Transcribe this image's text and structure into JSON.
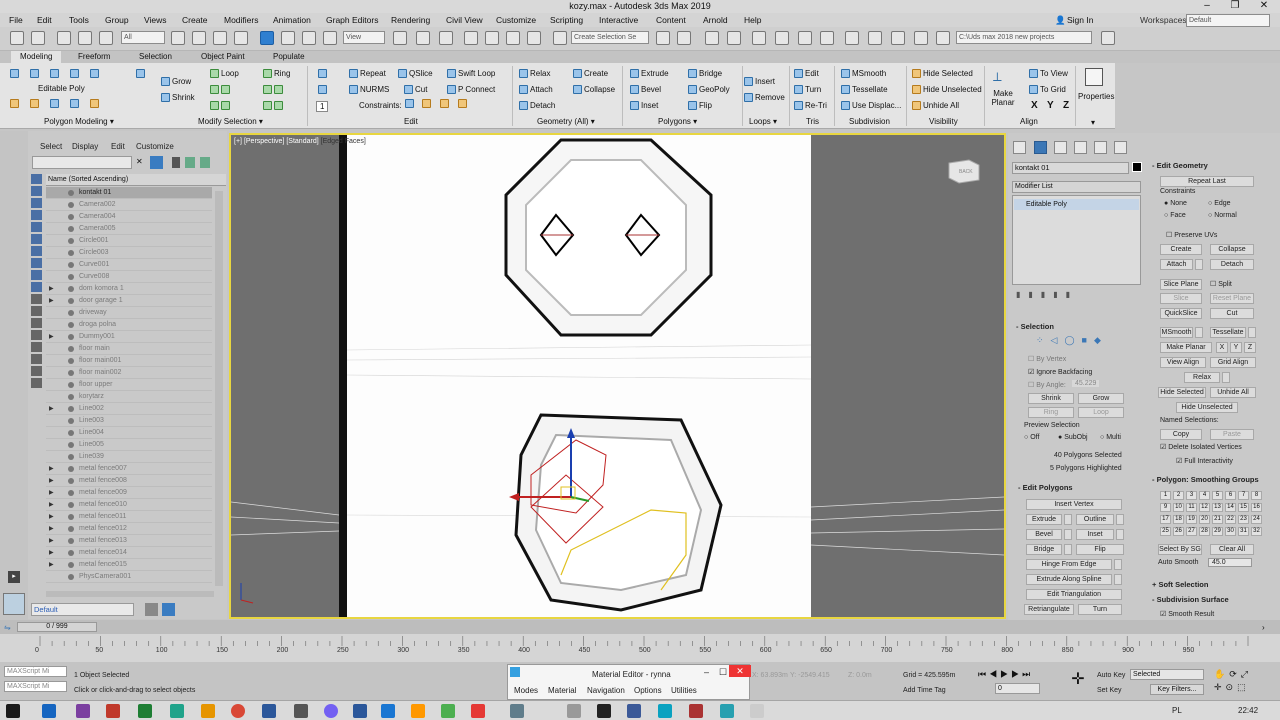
{
  "title": "kozy.max - Autodesk 3ds Max 2019",
  "menu": [
    "File",
    "Edit",
    "Tools",
    "Group",
    "Views",
    "Create",
    "Modifiers",
    "Animation",
    "Graph Editors",
    "Rendering",
    "Civil View",
    "Customize",
    "Scripting",
    "Interactive",
    "Content",
    "Arnold",
    "Help"
  ],
  "signin": "Sign In",
  "workspaces_label": "Workspaces:",
  "workspace": "Default",
  "toolbar": {
    "filter": "All",
    "view": "View",
    "selection_set": "Create Selection Se",
    "project_path": "C:\\Uds max 2018 new projects"
  },
  "ribbon_tabs": [
    "Modeling",
    "Freeform",
    "Selection",
    "Object Paint",
    "Populate"
  ],
  "ribbon": {
    "editable_poly": "Editable Poly",
    "grow": "Grow",
    "shrink": "Shrink",
    "loop": "Loop",
    "ring": "Ring",
    "repeat": "Repeat",
    "qslice": "QSlice",
    "swift_loop": "Swift Loop",
    "nurms": "NURMS",
    "cut": "Cut",
    "p_connect": "P Connect",
    "constraints": "Constraints:",
    "relax": "Relax",
    "create": "Create",
    "attach": "Attach",
    "collapse": "Collapse",
    "detach": "Detach",
    "extrude": "Extrude",
    "bridge": "Bridge",
    "bevel": "Bevel",
    "geopoly": "GeoPoly",
    "inset": "Inset",
    "flip": "Flip",
    "insert": "Insert",
    "remove": "Remove",
    "edit": "Edit",
    "turn": "Turn",
    "re_tri": "Re-Tri",
    "msmooth": "MSmooth",
    "tessellate": "Tessellate",
    "use_displac": "Use Displac...",
    "hide_selected": "Hide Selected",
    "hide_unselected": "Hide Unselected",
    "unhide_all": "Unhide All",
    "make_planar": "Make Planar",
    "to_view": "To View",
    "to_grid": "To Grid",
    "x": "X",
    "y": "Y",
    "z": "Z",
    "properties": "Properties",
    "footer": [
      "Polygon Modeling ▾",
      "Modify Selection ▾",
      "Edit",
      "Geometry (All) ▾",
      "Polygons ▾",
      "Loops ▾",
      "Tris",
      "Subdivision",
      "Visibility",
      "Align"
    ]
  },
  "explorer": {
    "menu": [
      "Select",
      "Display",
      "Edit",
      "Customize"
    ],
    "header": "Name (Sorted Ascending)",
    "rows": [
      "kontakt 01",
      "Camera002",
      "Camera004",
      "Camera005",
      "Circle001",
      "Circle003",
      "Curve001",
      "Curve008",
      "dom komora 1",
      "door garage 1",
      "driveway",
      "droga polna",
      "Dummy001",
      "floor main",
      "floor main001",
      "floor main002",
      "floor upper",
      "korytarz",
      "Line002",
      "Line003",
      "Line004",
      "Line005",
      "Line039",
      "metal fence007",
      "metal fence008",
      "metal fence009",
      "metal fence010",
      "metal fence011",
      "metal fence012",
      "metal fence013",
      "metal fence014",
      "metal fence015",
      "PhysCamera001"
    ],
    "expandable": [
      8,
      9,
      12,
      18,
      23,
      24,
      25,
      26,
      27,
      28,
      29,
      30,
      31
    ],
    "layer": "Default"
  },
  "viewport": {
    "label_parts": [
      "[+]",
      "[Perspective]",
      "[Standard]",
      "[Edged Faces]"
    ],
    "viewcube": "BACK"
  },
  "command": {
    "object_name": "kontakt 01",
    "modifier_list": "Modifier List",
    "stack_item": "Editable Poly",
    "selection": {
      "title": "Selection",
      "by_vertex": "By Vertex",
      "ignore_backfacing": "Ignore Backfacing",
      "by_angle": "By Angle:",
      "angle": "45.229",
      "shrink": "Shrink",
      "grow": "Grow",
      "ring": "Ring",
      "loop": "Loop",
      "preview": "Preview Selection",
      "off": "Off",
      "subobj": "SubObj",
      "multi": "Multi",
      "count1": "40 Polygons Selected",
      "count2": "5 Polygons Highlighted"
    },
    "edit_polygons": {
      "title": "Edit Polygons",
      "insert_vertex": "Insert Vertex",
      "extrude": "Extrude",
      "outline": "Outline",
      "bevel": "Bevel",
      "inset": "Inset",
      "bridge": "Bridge",
      "flip": "Flip",
      "hinge": "Hinge From Edge",
      "extrude_spline": "Extrude Along Spline",
      "edit_tri": "Edit Triangulation",
      "retriangulate": "Retriangulate",
      "turn": "Turn"
    },
    "edit_geometry": {
      "title": "Edit Geometry",
      "repeat_last": "Repeat Last",
      "constraints": "Constraints",
      "none": "None",
      "edge": "Edge",
      "face": "Face",
      "normal": "Normal",
      "preserve_uvs": "Preserve UVs",
      "create": "Create",
      "collapse": "Collapse",
      "attach": "Attach",
      "detach": "Detach",
      "slice_plane": "Slice Plane",
      "split": "Split",
      "slice": "Slice",
      "reset_plane": "Reset Plane",
      "quickslice": "QuickSlice",
      "cut": "Cut",
      "msmooth": "MSmooth",
      "tessellate": "Tessellate",
      "make_planar": "Make Planar",
      "x": "X",
      "y": "Y",
      "z": "Z",
      "view_align": "View Align",
      "grid_align": "Grid Align",
      "relax": "Relax",
      "hide_selected": "Hide Selected",
      "unhide_all": "Unhide All",
      "hide_unselected": "Hide Unselected",
      "named_selections": "Named Selections:",
      "copy": "Copy",
      "paste": "Paste",
      "delete_isolated": "Delete Isolated Vertices",
      "full_interactivity": "Full Interactivity"
    },
    "smoothing": {
      "title": "Polygon: Smoothing Groups",
      "groups": [
        1,
        2,
        3,
        4,
        5,
        6,
        7,
        8,
        9,
        10,
        11,
        12,
        13,
        14,
        15,
        16,
        17,
        18,
        19,
        20,
        21,
        22,
        23,
        24,
        25,
        26,
        27,
        28,
        29,
        30,
        31,
        32
      ],
      "select_by_sg": "Select By SG",
      "clear_all": "Clear All",
      "auto_smooth": "Auto Smooth",
      "auto_value": "45.0"
    },
    "soft_selection": "Soft Selection",
    "subdivision": "Subdivision Surface",
    "smooth_result": "Smooth Result"
  },
  "timeline": {
    "frame": "0 / 999",
    "ticks": [
      0,
      50,
      100,
      150,
      200,
      250,
      300,
      350,
      400,
      450,
      500,
      550,
      600,
      650,
      700,
      750,
      800,
      850,
      900,
      950
    ]
  },
  "status": {
    "maxscript": "MAXScript Mi",
    "objects": "1 Object Selected",
    "hint": "Click or click-and-drag to select objects",
    "x_val": "X: 63.893m",
    "y_val": "Y: -2549.415",
    "z_val": "Z: 0.0m",
    "grid": "Grid = 425.595m",
    "add_time_tag": "Add Time Tag",
    "auto_key": "Auto Key",
    "set_key": "Set Key",
    "selected": "Selected",
    "key_filters": "Key Filters...",
    "frame_value": "0"
  },
  "material_editor": {
    "title": "Material Editor - rynna",
    "menu": [
      "Modes",
      "Material",
      "Navigation",
      "Options",
      "Utilities"
    ]
  },
  "taskbar": {
    "lang": "PL",
    "time": "22:42"
  }
}
